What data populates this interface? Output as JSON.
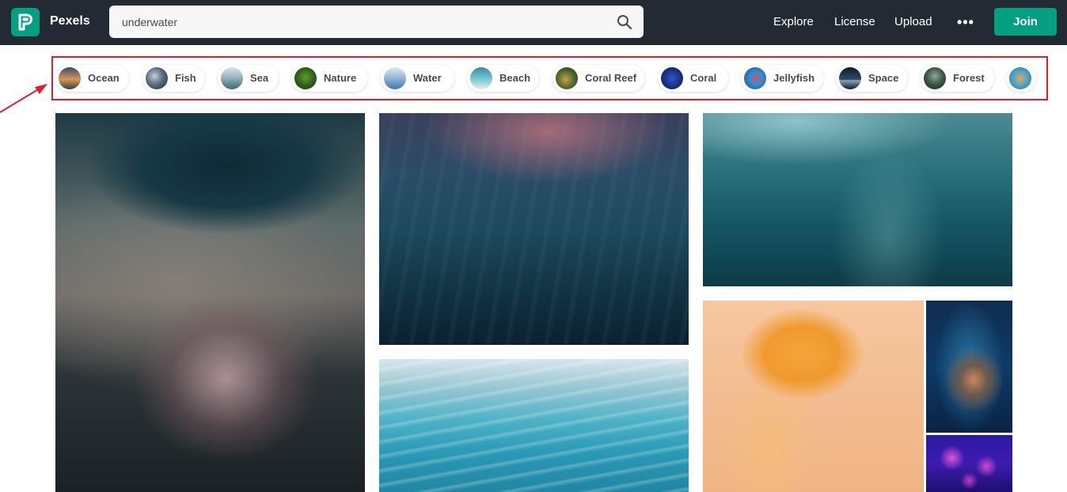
{
  "header": {
    "brand": "Pexels",
    "search": {
      "value": "underwater",
      "placeholder": "Search for free photos"
    },
    "nav": {
      "explore": "Explore",
      "license": "License",
      "upload": "Upload",
      "more": "•••"
    },
    "join_label": "Join"
  },
  "colors": {
    "header_bg": "#232a34",
    "brand_green": "#05a081",
    "annotation_red": "#e11d2a"
  },
  "chips": [
    {
      "label": "Ocean"
    },
    {
      "label": "Fish"
    },
    {
      "label": "Sea"
    },
    {
      "label": "Nature"
    },
    {
      "label": "Water"
    },
    {
      "label": "Beach"
    },
    {
      "label": "Coral Reef"
    },
    {
      "label": "Coral"
    },
    {
      "label": "Jellyfish"
    },
    {
      "label": "Space"
    },
    {
      "label": "Forest"
    }
  ]
}
